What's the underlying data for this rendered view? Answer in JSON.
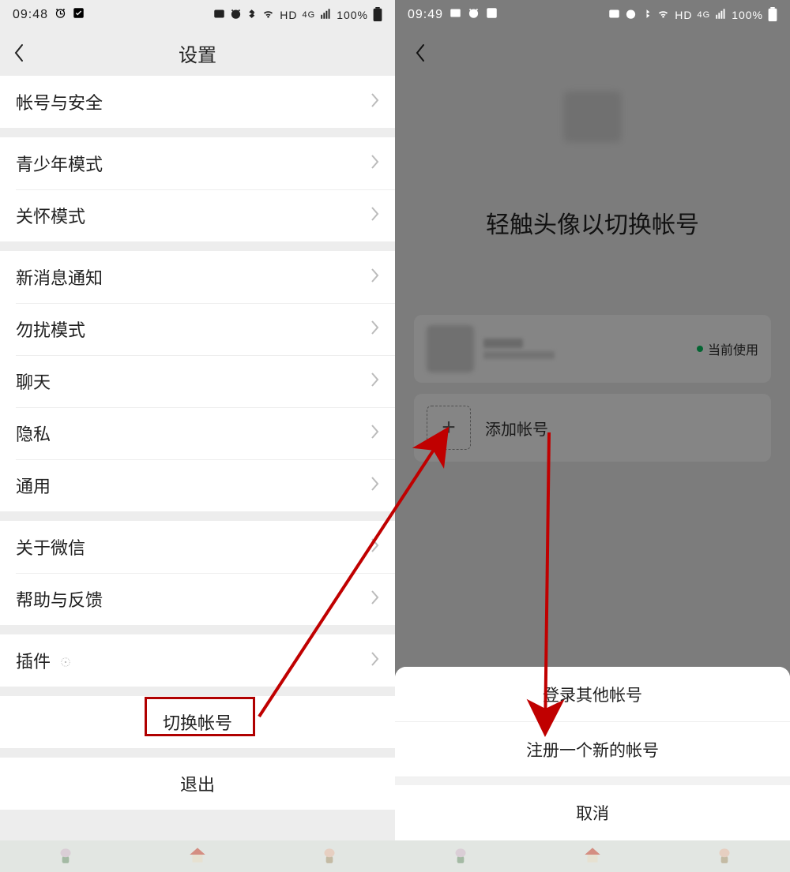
{
  "status": {
    "time_left": "09:48",
    "time_right": "09:49",
    "network": "HD",
    "signal": "4G",
    "battery": "100%"
  },
  "left": {
    "title": "设置",
    "groups": [
      [
        {
          "label": "帐号与安全"
        }
      ],
      [
        {
          "label": "青少年模式"
        },
        {
          "label": "关怀模式"
        }
      ],
      [
        {
          "label": "新消息通知"
        },
        {
          "label": "勿扰模式"
        },
        {
          "label": "聊天"
        },
        {
          "label": "隐私"
        },
        {
          "label": "通用"
        }
      ],
      [
        {
          "label": "关于微信"
        },
        {
          "label": "帮助与反馈"
        }
      ],
      [
        {
          "label": "插件",
          "badge": true
        }
      ]
    ],
    "switch_account": "切换帐号",
    "logout": "退出"
  },
  "right": {
    "title": "轻触头像以切换帐号",
    "current_label": "当前使用",
    "add_account": "添加帐号",
    "sheet": {
      "login_other": "登录其他帐号",
      "register_new": "注册一个新的帐号",
      "cancel": "取消"
    }
  },
  "annotation": {
    "highlight": "切换帐号",
    "arrow1": "to add account",
    "arrow2": "to register new"
  }
}
